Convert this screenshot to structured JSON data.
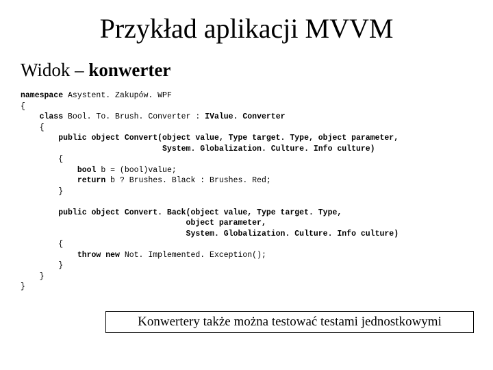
{
  "title": "Przykład aplikacji MVVM",
  "subtitle_plain": "Widok – ",
  "subtitle_bold": "konwerter",
  "code": {
    "l1a": "namespace",
    "l1b": " Asystent. Zakupów. WPF",
    "l2": "{",
    "l3a": "    class",
    "l3b": " Bool. To. Brush. Converter : ",
    "l3c": "IValue. Converter",
    "l4": "    {",
    "l5a": "        public object Convert(object value, Type target. Type, object parameter,",
    "l6a": "                              System. Globalization. Culture. Info culture)",
    "l7": "        {",
    "l8a": "            bool",
    "l8b": " b = (bool)value;",
    "l9a": "            return",
    "l9b": " b ? Brushes. Black : Brushes. Red;",
    "l10": "        }",
    "blank": "",
    "l11a": "        public object Convert. Back(object value, Type target. Type,",
    "l12a": "                                   object parameter,",
    "l13a": "                                   System. Globalization. Culture. Info culture)",
    "l14": "        {",
    "l15a": "            throw new",
    "l15b": " Not. Implemented. Exception();",
    "l16": "        }",
    "l17": "    }",
    "l18": "}"
  },
  "callout": "Konwertery także można testować testami jednostkowymi"
}
